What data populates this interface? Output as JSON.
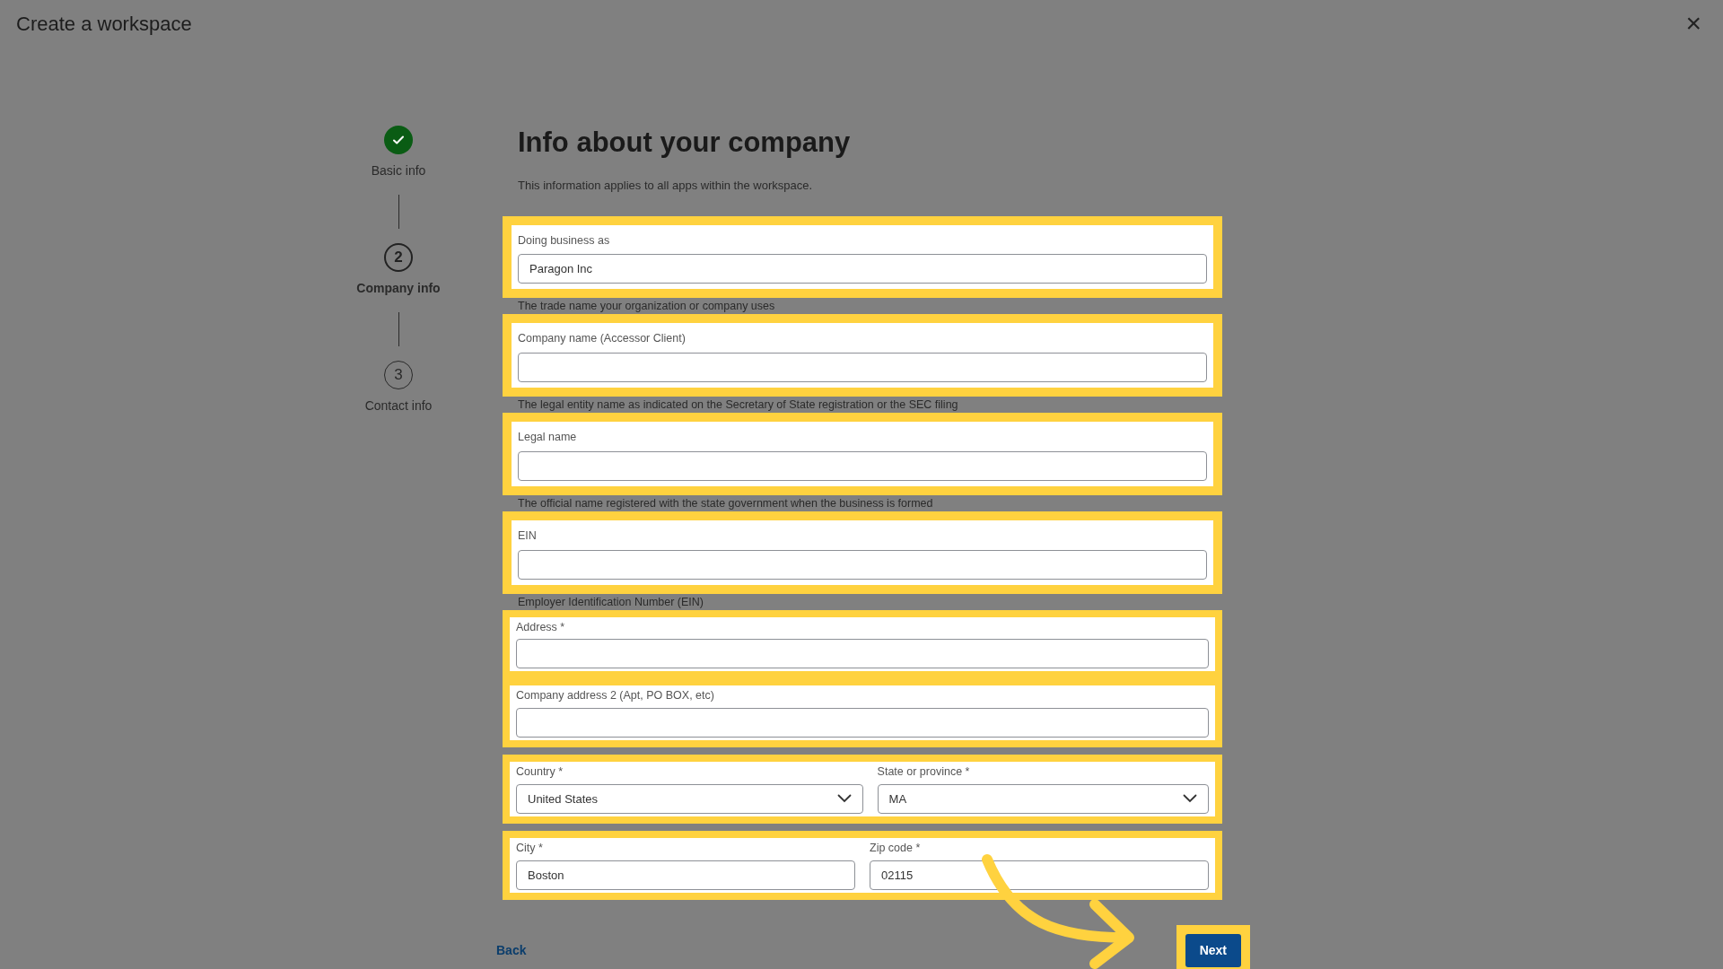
{
  "window": {
    "title": "Create a workspace",
    "close": "×"
  },
  "steps": [
    {
      "label": "Basic info",
      "done": true,
      "current": false
    },
    {
      "label": "Company info",
      "number": "2",
      "done": false,
      "current": true
    },
    {
      "label": "Contact info",
      "number": "3",
      "done": false,
      "current": false
    }
  ],
  "heading": "Info about your company",
  "description": "This information applies to all apps within the workspace.",
  "groups": [
    {
      "highlighted": true,
      "fields": [
        {
          "kind": "text",
          "label": "Doing business as",
          "value": "Paragon Inc"
        }
      ],
      "helper": "The trade name your organization or company uses"
    },
    {
      "highlighted": true,
      "fields": [
        {
          "kind": "text",
          "label": "Company name (Accessor Client)"
        }
      ],
      "helper": "The legal entity name as indicated on the Secretary of State registration or the SEC filing"
    },
    {
      "highlighted": true,
      "fields": [
        {
          "kind": "text",
          "label": "Legal name"
        }
      ],
      "helper": "The official name registered with the state government when the business is formed"
    },
    {
      "highlighted": true,
      "fields": [
        {
          "kind": "text",
          "label": "EIN"
        }
      ],
      "helper": "Employer Identification Number (EIN)"
    },
    {
      "highlighted": true,
      "fields": [
        {
          "kind": "text",
          "label": "Address *"
        }
      ]
    },
    {
      "highlighted": true,
      "fields": [
        {
          "kind": "text",
          "label": "Company address 2 (Apt, PO BOX, etc)"
        }
      ]
    },
    {
      "highlighted": true,
      "fields": [
        {
          "kind": "select",
          "label": "Country *",
          "value": "United States"
        },
        {
          "kind": "select",
          "label": "State or province *",
          "value": "MA"
        }
      ]
    },
    {
      "highlighted": true,
      "fields": [
        {
          "kind": "text",
          "label": "City *",
          "value": "Boston"
        },
        {
          "kind": "text",
          "label": "Zip code *",
          "value": "02115"
        }
      ]
    }
  ],
  "back": "Back",
  "next": {
    "label": "Next",
    "highlighted": true
  },
  "annotation_arrow": true
}
